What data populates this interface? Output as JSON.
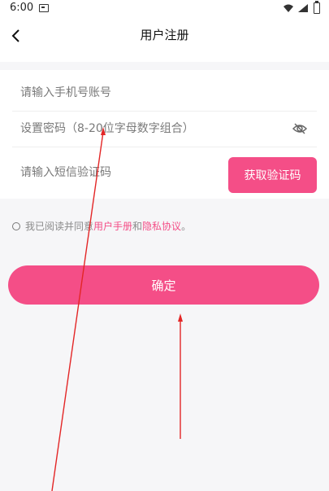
{
  "status_bar": {
    "time": "6:00"
  },
  "header": {
    "title": "用户注册"
  },
  "form": {
    "phone_placeholder": "请输入手机号账号",
    "password_placeholder": "设置密码（8-20位字母数字组合）",
    "code_placeholder": "请输入短信验证码",
    "code_button_label": "获取验证码"
  },
  "agreement": {
    "text_prefix": "我已阅读并同意",
    "manual_link": "用户手册",
    "and_text": "和",
    "privacy_link": "隐私协议",
    "period": "。"
  },
  "confirm": {
    "label": "确定"
  },
  "colors": {
    "accent": "#f44e87",
    "annotation": "#e32626"
  },
  "icons": {
    "back": "chevron-left-icon",
    "eye": "eye-slash-icon",
    "wifi": "wifi-icon",
    "signal": "signal-icon",
    "battery": "battery-icon"
  }
}
